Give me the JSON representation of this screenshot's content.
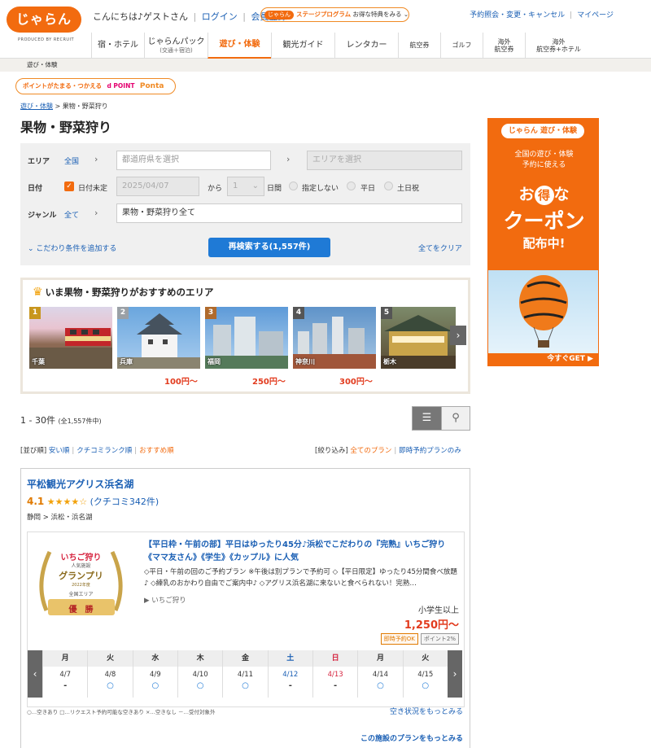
{
  "header": {
    "logo": "じゃらん",
    "logo_sub": "PRODUCED BY RECRUIT",
    "greeting": "こんにちは♪ゲストさん",
    "login": "ログイン",
    "register": "会員登録",
    "stage_badge": "じゃらん",
    "stage_program": "ステージプログラム",
    "stage_text": "お得な特典をみる",
    "reservation_link": "予約照会・変更・キャンセル",
    "mypage_link": "マイページ"
  },
  "nav": [
    {
      "label": "宿・ホテル",
      "sub": ""
    },
    {
      "label": "じゃらんパック",
      "sub": "(交通＋宿泊)"
    },
    {
      "label": "遊び・体験",
      "sub": ""
    },
    {
      "label": "観光ガイド",
      "sub": ""
    },
    {
      "label": "レンタカー",
      "sub": ""
    },
    {
      "label": "航空券",
      "sub": ""
    },
    {
      "label": "ゴルフ",
      "sub": ""
    },
    {
      "label": "海外",
      "sub": "航空券"
    },
    {
      "label": "海外",
      "sub": "航空券+ホテル"
    }
  ],
  "crumb_bar": "遊び・体験",
  "points": {
    "text": "ポイントがたまる・つかえる",
    "dpoint": "d POINT",
    "ponta": "Ponta"
  },
  "breadcrumb": {
    "root": "遊び・体験",
    "sep": ">",
    "current": "果物・野菜狩り"
  },
  "page_title": "果物・野菜狩り",
  "search": {
    "area_label": "エリア",
    "area_value": "全国",
    "pref_placeholder": "都道府県を選択",
    "area_placeholder": "エリアを選択",
    "date_label": "日付",
    "date_undecided": "日付未定",
    "date_value": "2025/04/07",
    "from": "から",
    "days_value": "1",
    "days_unit": "日間",
    "opt_none": "指定しない",
    "opt_weekday": "平日",
    "opt_weekend": "土日祝",
    "genre_label": "ジャンル",
    "genre_value": "全て",
    "genre_field": "果物・野菜狩り全て",
    "more_conditions": "こだわり条件を追加する",
    "search_button": "再検索する(1,557件)",
    "clear": "全てをクリア"
  },
  "recommend": {
    "title": "いま果物・野菜狩りがおすすめのエリア",
    "cards": [
      {
        "rank": "1",
        "name": "千葉",
        "price": "",
        "rank_color": "#c8961e"
      },
      {
        "rank": "2",
        "name": "兵庫",
        "price": "100円～",
        "rank_color": "#9aa0a6"
      },
      {
        "rank": "3",
        "name": "福岡",
        "price": "250円～",
        "rank_color": "#b06a2c"
      },
      {
        "rank": "4",
        "name": "神奈川",
        "price": "300円～",
        "rank_color": "#555555"
      },
      {
        "rank": "5",
        "name": "栃木",
        "price": "",
        "rank_color": "#555555"
      }
    ]
  },
  "results": {
    "count": "1 - 30件",
    "total": "(全1,557件中)"
  },
  "sort": {
    "label": "[並び順]",
    "cheap": "安い順",
    "review": "クチコミランク順",
    "recommend": "おすすめ順"
  },
  "filter": {
    "label": "[絞り込み]",
    "all": "全てのプラン",
    "instant": "即時予約プランのみ"
  },
  "facility": {
    "name": "平松観光アグリス浜名湖",
    "rating": "4.1",
    "stars": "★★★★☆",
    "reviews": "(クチコミ342件)",
    "location": "静岡 > 浜松・浜名湖",
    "badge_title": "いちご狩り",
    "badge_sub": "人気施設",
    "badge_grandprix": "グランプリ",
    "badge_year": "2022年度",
    "badge_area": "全国エリア",
    "badge_win": "優　勝",
    "plan_title": "【平日枠・午前の部】平日はゆったり45分♪浜松でこだわりの『完熟』いちご狩り《ママ友さん》《学生》《カップル》に人気",
    "plan_desc": "◇平日・午前の回のご予約プラン ※午後は別プランで予約可 ◇【平日限定】ゆったり45分間食べ放題♪ ◇練乳のおかわり自由でご案内中♪ ◇アグリス浜名湖に来ないと食べられない！完熟…",
    "plan_tag": "いちご狩り",
    "age": "小学生以上",
    "price": "1,250円～",
    "tag_instant": "即時予約OK",
    "tag_point": "ポイント2%",
    "calendar": [
      {
        "dow": "月",
        "date": "4/7",
        "mark": "-",
        "type": ""
      },
      {
        "dow": "火",
        "date": "4/8",
        "mark": "○",
        "type": ""
      },
      {
        "dow": "水",
        "date": "4/9",
        "mark": "○",
        "type": ""
      },
      {
        "dow": "木",
        "date": "4/10",
        "mark": "○",
        "type": ""
      },
      {
        "dow": "金",
        "date": "4/11",
        "mark": "○",
        "type": ""
      },
      {
        "dow": "土",
        "date": "4/12",
        "mark": "-",
        "type": "sat"
      },
      {
        "dow": "日",
        "date": "4/13",
        "mark": "-",
        "type": "sun"
      },
      {
        "dow": "月",
        "date": "4/14",
        "mark": "○",
        "type": ""
      },
      {
        "dow": "火",
        "date": "4/15",
        "mark": "○",
        "type": ""
      }
    ],
    "legend": "○…空きあり □…リクエスト予約可能な空きあり ×…空きなし －…受付対象外",
    "availability_link": "空き状況をもっとみる",
    "more_plans": "この施設のプランをもっとみる"
  },
  "ad": {
    "logo": "じゃらん 遊び・体験",
    "line1": "全国の遊び・体験",
    "line2": "予約に使える",
    "big1a": "お",
    "big1b": "得",
    "big1c": "な",
    "big2": "クーポン",
    "big3": "配布中!",
    "cta": "今すぐGET ▶"
  },
  "colors": {
    "brand": "#f26b0f",
    "link": "#1a5fb4",
    "price": "#e23c1f",
    "button": "#1f7ad6"
  }
}
